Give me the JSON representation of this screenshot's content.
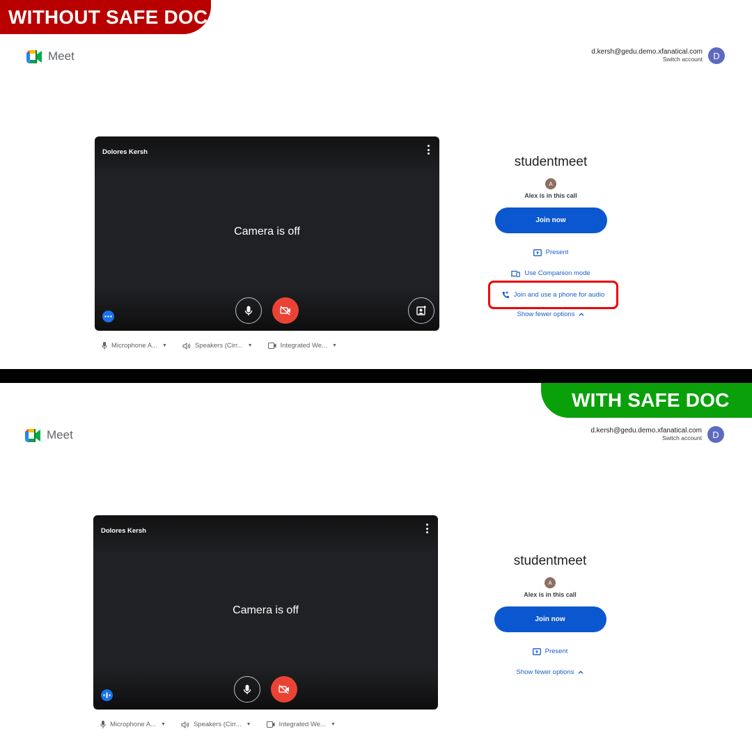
{
  "comparison": {
    "top_label": "WITHOUT SAFE DOC",
    "bottom_label": "WITH SAFE DOC",
    "colors": {
      "without": "#b80000",
      "with": "#0aa00a"
    }
  },
  "panels": [
    {
      "app": {
        "name": "Meet"
      },
      "account": {
        "email": "d.kersh@gedu.demo.xfanatical.com",
        "switch_label": "Switch account",
        "avatar_initial": "D"
      },
      "preview": {
        "participant_name": "Dolores Kersh",
        "status_text": "Camera is off",
        "controls": {
          "mic": "on",
          "camera": "off"
        },
        "corner_indicator": "more-options",
        "has_effects_button": true
      },
      "devices": [
        {
          "icon": "microphone-icon",
          "label": "Microphone A..."
        },
        {
          "icon": "speaker-icon",
          "label": "Speakers (Cirr..."
        },
        {
          "icon": "video-camera-icon",
          "label": "Integrated We..."
        }
      ],
      "join": {
        "meeting_name": "studentmeet",
        "participant_initial": "A",
        "participant_text": "Alex is in this call",
        "join_label": "Join now",
        "options": [
          {
            "icon": "present-icon",
            "label": "Present"
          },
          {
            "icon": "companion-mode-icon",
            "label": "Use Companion mode"
          },
          {
            "icon": "phone-icon",
            "label": "Join and use a phone for audio",
            "highlighted": true
          }
        ],
        "toggle_label": "Show fewer options"
      }
    },
    {
      "app": {
        "name": "Meet"
      },
      "account": {
        "email": "d.kersh@gedu.demo.xfanatical.com",
        "switch_label": "Switch account",
        "avatar_initial": "D"
      },
      "preview": {
        "participant_name": "Dolores Kersh",
        "status_text": "Camera is off",
        "controls": {
          "mic": "on",
          "camera": "off"
        },
        "corner_indicator": "audio-level",
        "has_effects_button": false
      },
      "devices": [
        {
          "icon": "microphone-icon",
          "label": "Microphone A..."
        },
        {
          "icon": "speaker-icon",
          "label": "Speakers (Cirr..."
        },
        {
          "icon": "video-camera-icon",
          "label": "Integrated We..."
        }
      ],
      "join": {
        "meeting_name": "studentmeet",
        "participant_initial": "A",
        "participant_text": "Alex is in this call",
        "join_label": "Join now",
        "options": [
          {
            "icon": "present-icon",
            "label": "Present"
          }
        ],
        "toggle_label": "Show fewer options"
      }
    }
  ]
}
